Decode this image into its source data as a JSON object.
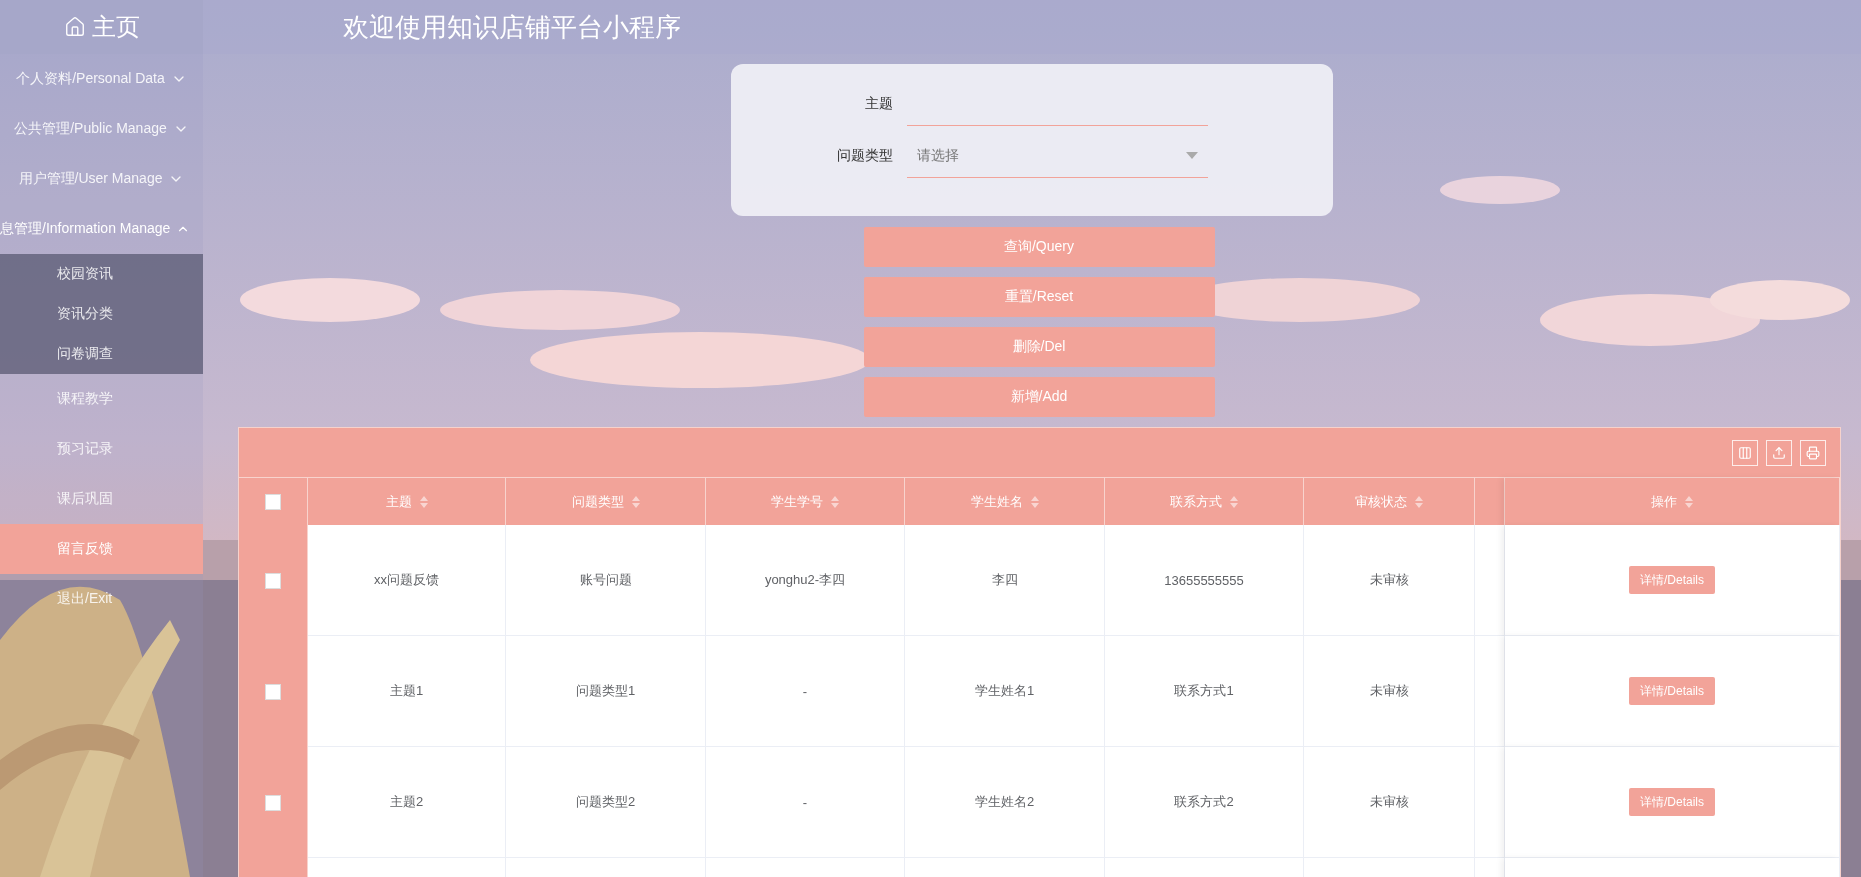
{
  "header": {
    "home": "主页",
    "title": "欢迎使用知识店铺平台小程序"
  },
  "sidebar": {
    "items": [
      {
        "label": "个人资料/Personal Data",
        "kind": "group",
        "expanded": false
      },
      {
        "label": "公共管理/Public Manage",
        "kind": "group",
        "expanded": false
      },
      {
        "label": "用户管理/User Manage",
        "kind": "group",
        "expanded": false
      },
      {
        "label": "息管理/Information Manage",
        "kind": "group",
        "expanded": true,
        "children": [
          {
            "label": "校园资讯",
            "selected": false
          },
          {
            "label": "资讯分类",
            "selected": false
          },
          {
            "label": "问卷调查",
            "selected": false
          }
        ]
      },
      {
        "label": "课程教学",
        "kind": "link",
        "selected": false
      },
      {
        "label": "预习记录",
        "kind": "link",
        "selected": false
      },
      {
        "label": "课后巩固",
        "kind": "link",
        "selected": false
      },
      {
        "label": "留言反馈",
        "kind": "link",
        "selected": true
      },
      {
        "label": "退出/Exit",
        "kind": "link",
        "selected": false
      }
    ]
  },
  "search": {
    "fields": [
      {
        "label": "主题",
        "kind": "text"
      },
      {
        "label": "问题类型",
        "kind": "select",
        "placeholder": "请选择"
      }
    ],
    "buttons": [
      "查询/Query",
      "重置/Reset",
      "删除/Del",
      "新增/Add"
    ]
  },
  "table": {
    "all_checked": false,
    "columns": [
      "主题",
      "问题类型",
      "学生学号",
      "学生姓名",
      "联系方式",
      "审核状态",
      "操作"
    ],
    "rows": [
      {
        "checked": false,
        "cells": [
          "xx问题反馈",
          "账号问题",
          "yonghu2-李四",
          "李四",
          "13655555555",
          "未审核"
        ],
        "action": "详情/Details"
      },
      {
        "checked": false,
        "cells": [
          "主题1",
          "问题类型1",
          "-",
          "学生姓名1",
          "联系方式1",
          "未审核"
        ],
        "action": "详情/Details"
      },
      {
        "checked": false,
        "cells": [
          "主题2",
          "问题类型2",
          "-",
          "学生姓名2",
          "联系方式2",
          "未审核"
        ],
        "action": "详情/Details"
      }
    ]
  }
}
